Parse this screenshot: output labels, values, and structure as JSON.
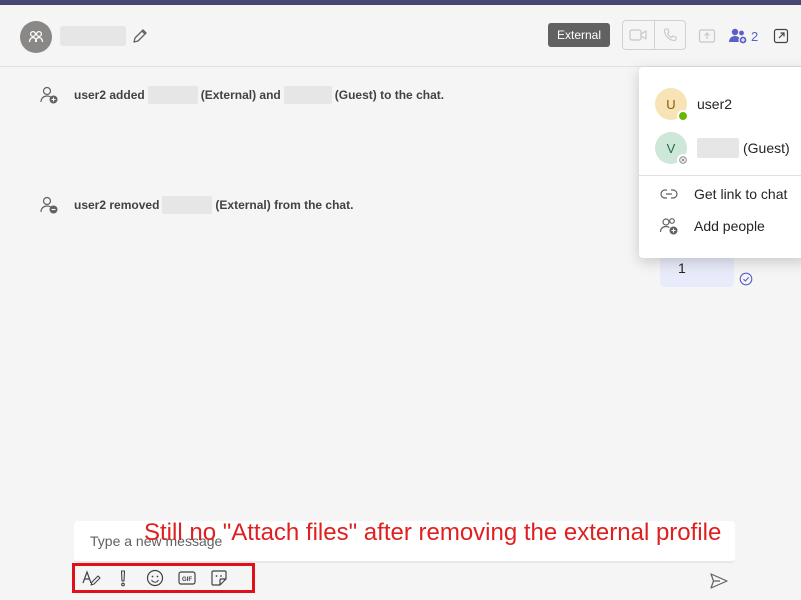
{
  "header": {
    "external_badge": "External",
    "participant_count": "2"
  },
  "messages": [
    {
      "actor": "user2",
      "verb": "added",
      "role_1": "(External) and",
      "role_2": "(Guest) to the chat."
    },
    {
      "actor": "user2",
      "verb": "removed",
      "role_1": "(External) from the chat."
    }
  ],
  "my_message": {
    "text": "1"
  },
  "participants_popup": {
    "members": [
      {
        "initial": "U",
        "name": "user2",
        "status": "available",
        "avatar_color": "#f7e3b5",
        "initial_color": "#8a5a00"
      },
      {
        "initial": "V",
        "name": "(Guest)",
        "status": "offline",
        "avatar_color": "#cde7d8",
        "initial_color": "#1f6e46"
      }
    ],
    "actions": [
      {
        "label": "Get link to chat",
        "icon": "link-icon"
      },
      {
        "label": "Add people",
        "icon": "add-people-icon"
      }
    ]
  },
  "composer": {
    "placeholder": "Type a new message"
  },
  "annotation": {
    "text": "Still no \"Attach files\" after removing the external profile",
    "color": "#e02020"
  },
  "colors": {
    "accent": "#5b5fc7",
    "topbar": "#464775"
  }
}
